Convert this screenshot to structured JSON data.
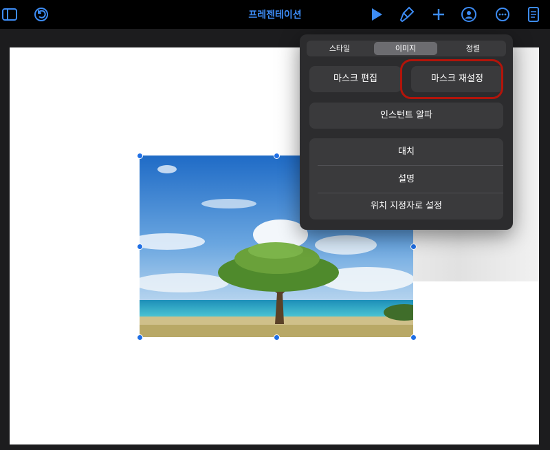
{
  "toolbar": {
    "title": "프레젠테이션",
    "accent_color": "#3d8cf5",
    "icons_left": [
      "sidebar-icon",
      "undo-icon"
    ],
    "icons_right": [
      "play-icon",
      "paintbrush-icon",
      "plus-icon",
      "collaborate-icon",
      "more-icon",
      "document-icon"
    ]
  },
  "popover": {
    "tabs": [
      {
        "label": "스타일",
        "selected": false
      },
      {
        "label": "이미지",
        "selected": true
      },
      {
        "label": "정렬",
        "selected": false
      }
    ],
    "buttons": {
      "edit_mask": "마스크 편집",
      "reset_mask": "마스크 재설정",
      "instant_alpha": "인스턴트 알파"
    },
    "list": [
      "대치",
      "설명",
      "위치 지정자로 설정"
    ]
  },
  "highlight_color": "#b3140a"
}
